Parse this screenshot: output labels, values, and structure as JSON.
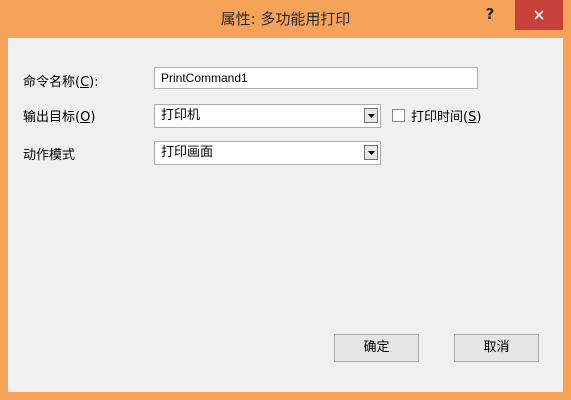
{
  "window": {
    "title": "属性: 多功能用打印",
    "help_label": "?",
    "accent": "#f5a359",
    "close_color": "#c7403a"
  },
  "form": {
    "command_name": {
      "label": "命令名称(",
      "mnemonic": "C",
      "suffix": "):",
      "value": "PrintCommand1"
    },
    "output_target": {
      "label": "输出目标(",
      "mnemonic": "O",
      "suffix": ")",
      "value": "打印机"
    },
    "print_time": {
      "label": "打印时间(",
      "mnemonic": "S",
      "suffix": ")",
      "checked": false
    },
    "action_mode": {
      "label": "动作模式",
      "value": "打印画面"
    }
  },
  "buttons": {
    "ok": "确定",
    "cancel": "取消"
  },
  "icons": {
    "close": "close-icon",
    "dropdown": "chevron-down-icon"
  }
}
